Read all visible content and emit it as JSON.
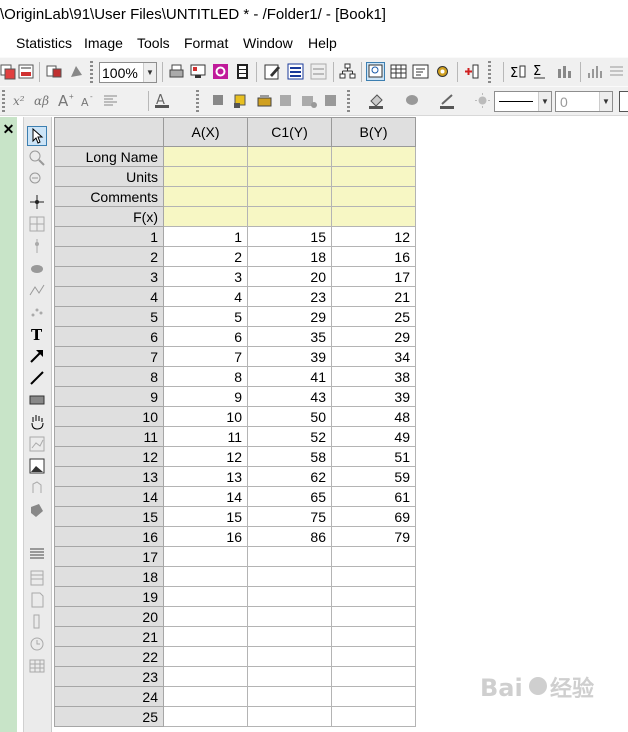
{
  "title": "\\OriginLab\\91\\User Files\\UNTITLED * - /Folder1/ - [Book1]",
  "menu": [
    "Statistics",
    "Image",
    "Tools",
    "Format",
    "Window",
    "Help"
  ],
  "toolbar": {
    "zoom_value": "100%",
    "line_width_value": "0",
    "icons_row1": [
      "duplicate-icon",
      "template-icon",
      "mask-icon",
      "mask-clear-icon",
      "print-icon",
      "export-icon",
      "image-icon",
      "film-icon",
      "notes-icon",
      "layout-icon",
      "layout-gray-icon",
      "project-tree-icon",
      "zoom-window-icon",
      "worksheet-icon",
      "script-icon",
      "gear-icon",
      "add-column-icon",
      "statistics-sum-icon",
      "statistics-column-icon",
      "bar-plot-icon"
    ],
    "icons_row2": [
      "italic-text-icon",
      "greek-icon",
      "font-larger-icon",
      "font-smaller-icon",
      "align-icon",
      "text-color-icon",
      "pour-icon",
      "mask-point-icon",
      "move-point-icon",
      "highlight-icon",
      "camera-icon",
      "fill-color-icon",
      "pattern-icon",
      "line-color-icon",
      "brightness-icon"
    ]
  },
  "tools": [
    "pointer-icon",
    "zoom-in-icon",
    "zoom-out-icon",
    "data-reader-icon",
    "screen-reader-icon",
    "data-picker-icon",
    "mask-icon",
    "region-mask-icon",
    "scatter-icon",
    "text-tool-icon",
    "arrow-tool-icon",
    "line-tool-icon",
    "rectangle-tool-icon",
    "hand-tool-icon",
    "graph-tool-icon",
    "image-tool-icon",
    "region-icon",
    "brush-icon",
    "bars-icon",
    "table-icon",
    "page-icon",
    "pin-icon",
    "clock-icon",
    "grid-icon"
  ],
  "worksheet": {
    "columns": [
      "A(X)",
      "C1(Y)",
      "B(Y)"
    ],
    "meta_rows": [
      "Long Name",
      "Units",
      "Comments",
      "F(x)"
    ],
    "rows": [
      {
        "n": "1",
        "a": "1",
        "c1": "15",
        "b": "12"
      },
      {
        "n": "2",
        "a": "2",
        "c1": "18",
        "b": "16"
      },
      {
        "n": "3",
        "a": "3",
        "c1": "20",
        "b": "17"
      },
      {
        "n": "4",
        "a": "4",
        "c1": "23",
        "b": "21"
      },
      {
        "n": "5",
        "a": "5",
        "c1": "29",
        "b": "25"
      },
      {
        "n": "6",
        "a": "6",
        "c1": "35",
        "b": "29"
      },
      {
        "n": "7",
        "a": "7",
        "c1": "39",
        "b": "34"
      },
      {
        "n": "8",
        "a": "8",
        "c1": "41",
        "b": "38"
      },
      {
        "n": "9",
        "a": "9",
        "c1": "43",
        "b": "39"
      },
      {
        "n": "10",
        "a": "10",
        "c1": "50",
        "b": "48"
      },
      {
        "n": "11",
        "a": "11",
        "c1": "52",
        "b": "49"
      },
      {
        "n": "12",
        "a": "12",
        "c1": "58",
        "b": "51"
      },
      {
        "n": "13",
        "a": "13",
        "c1": "62",
        "b": "59"
      },
      {
        "n": "14",
        "a": "14",
        "c1": "65",
        "b": "61"
      },
      {
        "n": "15",
        "a": "15",
        "c1": "75",
        "b": "69"
      },
      {
        "n": "16",
        "a": "16",
        "c1": "86",
        "b": "79"
      },
      {
        "n": "17",
        "a": "",
        "c1": "",
        "b": ""
      },
      {
        "n": "18",
        "a": "",
        "c1": "",
        "b": ""
      },
      {
        "n": "19",
        "a": "",
        "c1": "",
        "b": ""
      },
      {
        "n": "20",
        "a": "",
        "c1": "",
        "b": ""
      },
      {
        "n": "21",
        "a": "",
        "c1": "",
        "b": ""
      },
      {
        "n": "22",
        "a": "",
        "c1": "",
        "b": ""
      },
      {
        "n": "23",
        "a": "",
        "c1": "",
        "b": ""
      },
      {
        "n": "24",
        "a": "",
        "c1": "",
        "b": ""
      },
      {
        "n": "25",
        "a": "",
        "c1": "",
        "b": ""
      }
    ]
  },
  "colors": {
    "meta_row_bg": "#f7f7c4",
    "header_bg": "#dfdfdf",
    "left_panel": "#c8e4c8"
  }
}
